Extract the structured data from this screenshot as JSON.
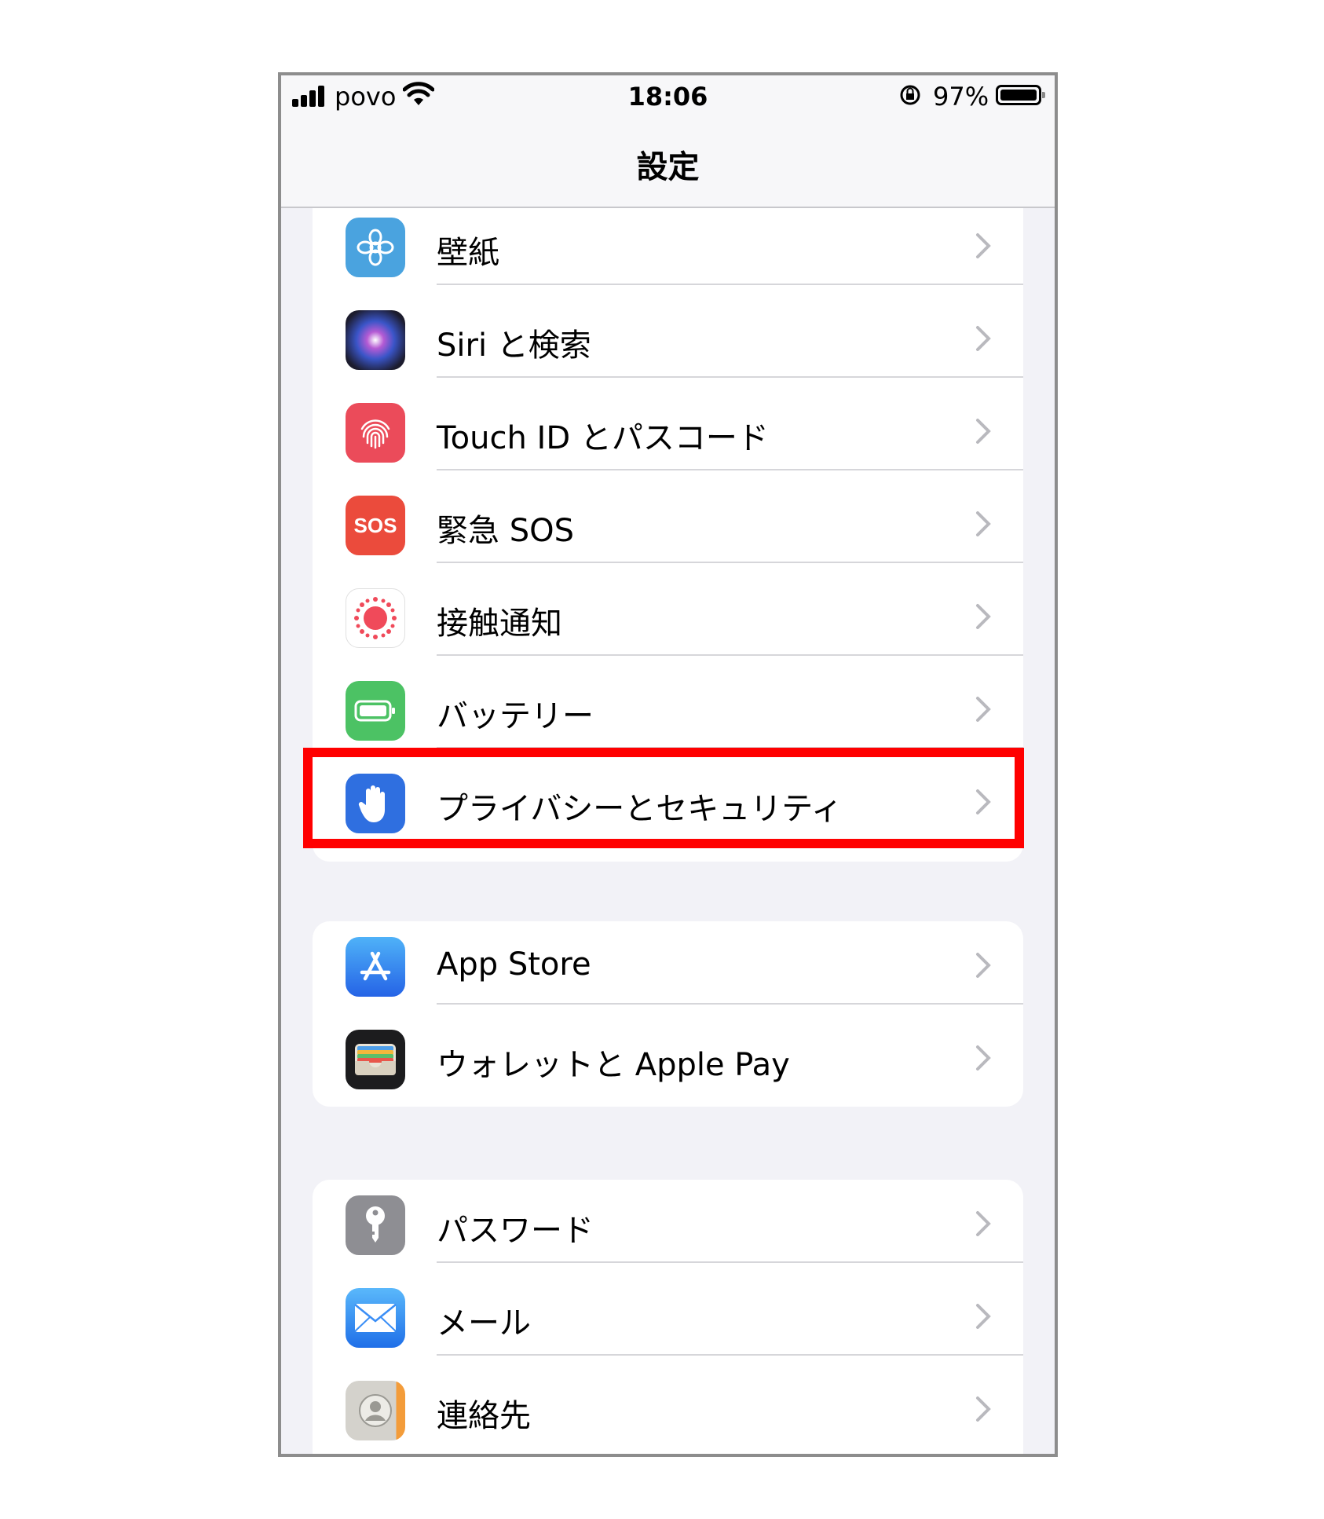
{
  "status_bar": {
    "carrier": "povo",
    "time": "18:06",
    "battery_percent": "97%"
  },
  "nav": {
    "title": "設定"
  },
  "groups": [
    {
      "items": [
        {
          "label": "壁紙",
          "icon": "wallpaper-flower-icon",
          "icon_color": "#4aa3df"
        },
        {
          "label": "Siri と検索",
          "icon": "siri-icon",
          "icon_color": "#1c1c2e"
        },
        {
          "label": "Touch ID とパスコード",
          "icon": "fingerprint-icon",
          "icon_color": "#eb4b5a"
        },
        {
          "label": "緊急 SOS",
          "icon": "sos-icon",
          "icon_color": "#eb4b3c",
          "icon_text": "SOS"
        },
        {
          "label": "接触通知",
          "icon": "exposure-notification-icon",
          "icon_color": "#ffffff"
        },
        {
          "label": "バッテリー",
          "icon": "battery-icon",
          "icon_color": "#4cc264"
        },
        {
          "label": "プライバシーとセキュリティ",
          "icon": "hand-icon",
          "icon_color": "#2f6fe0",
          "highlighted": true
        }
      ]
    },
    {
      "items": [
        {
          "label": "App Store",
          "icon": "app-store-icon",
          "icon_color": "#2f8ef5"
        },
        {
          "label": "ウォレットと Apple Pay",
          "icon": "wallet-icon",
          "icon_color": "#1c1c1e"
        }
      ]
    },
    {
      "items": [
        {
          "label": "パスワード",
          "icon": "key-icon",
          "icon_color": "#8e8e93"
        },
        {
          "label": "メール",
          "icon": "mail-icon",
          "icon_color": "#3a8ef6"
        },
        {
          "label": "連絡先",
          "icon": "contacts-icon",
          "icon_color": "#d8d8d8"
        }
      ]
    }
  ],
  "highlight_color": "#ff0000"
}
